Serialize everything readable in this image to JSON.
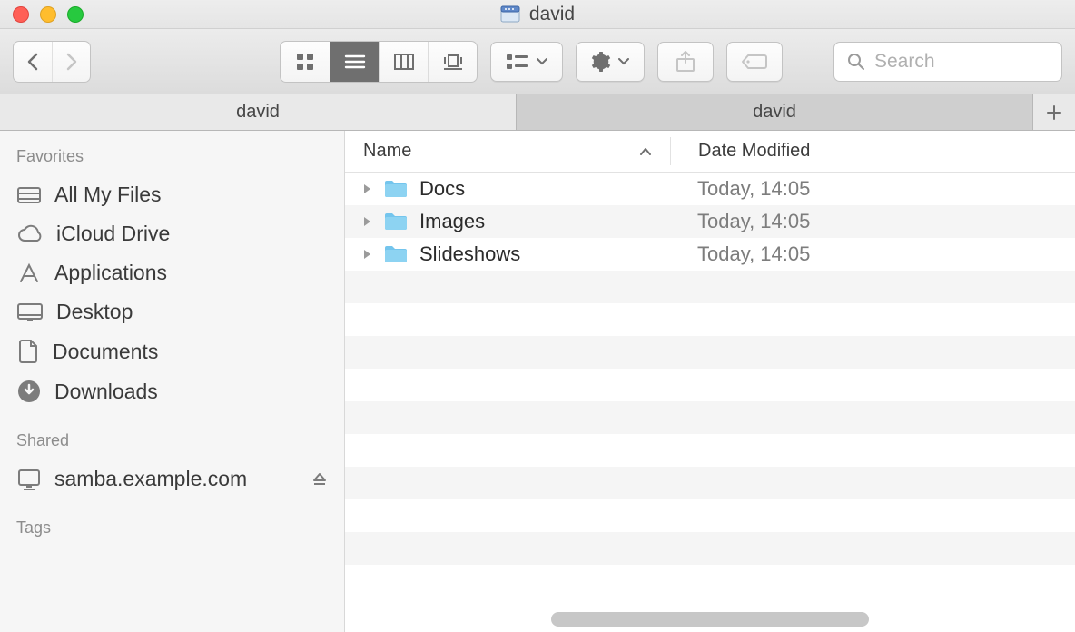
{
  "window": {
    "title": "david"
  },
  "toolbar": {
    "search_placeholder": "Search"
  },
  "tabs": [
    {
      "label": "david",
      "active": false
    },
    {
      "label": "david",
      "active": true
    }
  ],
  "sidebar": {
    "groups": [
      {
        "label": "Favorites",
        "items": [
          {
            "label": "All My Files",
            "icon": "all-my-files"
          },
          {
            "label": "iCloud Drive",
            "icon": "cloud"
          },
          {
            "label": "Applications",
            "icon": "applications"
          },
          {
            "label": "Desktop",
            "icon": "desktop"
          },
          {
            "label": "Documents",
            "icon": "documents"
          },
          {
            "label": "Downloads",
            "icon": "downloads"
          }
        ]
      },
      {
        "label": "Shared",
        "items": [
          {
            "label": "samba.example.com",
            "icon": "server",
            "ejectable": true
          }
        ]
      },
      {
        "label": "Tags",
        "items": []
      }
    ]
  },
  "columns": {
    "name": "Name",
    "date": "Date Modified"
  },
  "files": [
    {
      "name": "Docs",
      "date": "Today, 14:05",
      "kind": "folder"
    },
    {
      "name": "Images",
      "date": "Today, 14:05",
      "kind": "folder"
    },
    {
      "name": "Slideshows",
      "date": "Today, 14:05",
      "kind": "folder"
    }
  ],
  "colors": {
    "folder": "#74c5ed"
  }
}
